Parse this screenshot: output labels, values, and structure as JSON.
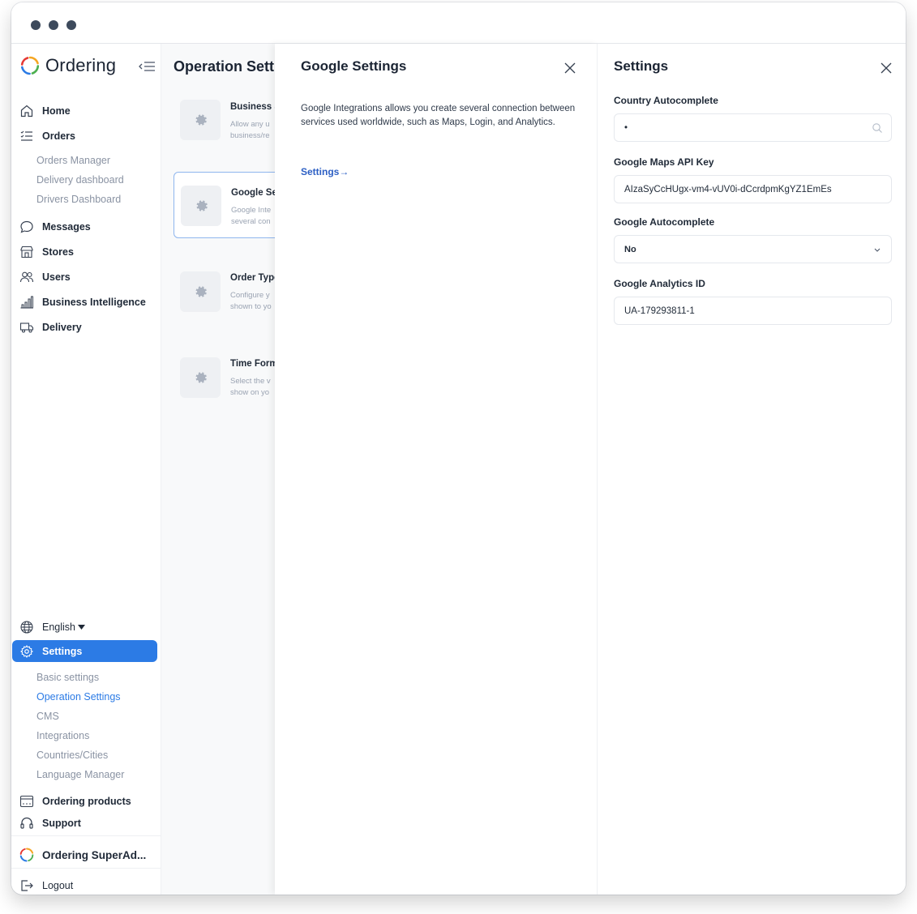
{
  "brand": {
    "name": "Ordering"
  },
  "sidebar": {
    "nav_top": [
      {
        "label": "Home",
        "icon": "home-icon"
      },
      {
        "label": "Orders",
        "icon": "list-icon"
      }
    ],
    "orders_sub": [
      "Orders Manager",
      "Delivery dashboard",
      "Drivers Dashboard"
    ],
    "nav_mid": [
      {
        "label": "Messages",
        "icon": "chat-icon"
      },
      {
        "label": "Stores",
        "icon": "store-icon"
      },
      {
        "label": "Users",
        "icon": "users-icon"
      },
      {
        "label": "Business Intelligence",
        "icon": "bar-chart-icon"
      },
      {
        "label": "Delivery",
        "icon": "truck-icon"
      }
    ],
    "language": "English",
    "settings_label": "Settings",
    "settings_sub": [
      "Basic settings",
      "Operation Settings",
      "CMS",
      "Integrations",
      "Countries/Cities",
      "Language Manager"
    ],
    "bottom": [
      {
        "label": "Ordering products",
        "icon": "products-icon"
      },
      {
        "label": "Support",
        "icon": "headset-icon"
      }
    ],
    "account": "Ordering SuperAd...",
    "logout": "Logout"
  },
  "operation": {
    "title": "Operation Settir",
    "cards": [
      {
        "title": "Business S",
        "desc1": "Allow any u",
        "desc2": "business/re"
      },
      {
        "title": "Google Set",
        "desc1": "Google Inte",
        "desc2": "several con"
      },
      {
        "title": "Order Type",
        "desc1": "Configure y",
        "desc2": "shown to yo"
      },
      {
        "title": "Time Form",
        "desc1": "Select the v",
        "desc2": "show on yo"
      }
    ]
  },
  "google_panel": {
    "title": "Google Settings",
    "description": "Google Integrations allows you create several connection between services used worldwide, such as Maps, Login, and Analytics.",
    "link": "Settings→"
  },
  "settings_panel": {
    "title": "Settings",
    "country_label": "Country Autocomplete",
    "country_value": "•",
    "maps_label": "Google Maps API Key",
    "maps_value": "AIzaSyCcHUgx-vm4-vUV0i-dCcrdpmKgYZ1EmEs",
    "autocomplete_label": "Google Autocomplete",
    "autocomplete_value": "No",
    "analytics_label": "Google Analytics ID",
    "analytics_value": "UA-179293811-1"
  },
  "colors": {
    "accent": "#2c7be5",
    "link": "#2c5fc4",
    "text": "#1f2937",
    "muted": "#8a93a3"
  }
}
